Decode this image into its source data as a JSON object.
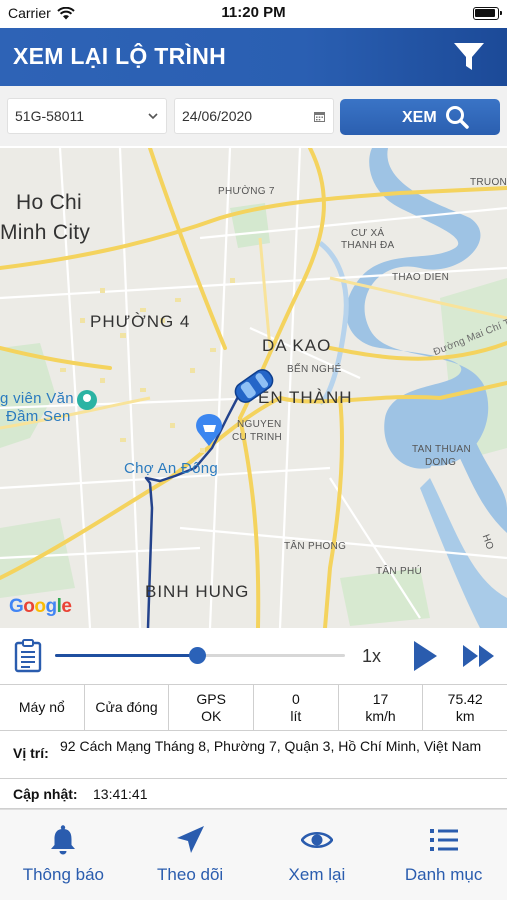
{
  "status_bar": {
    "carrier": "Carrier",
    "time": "11:20 PM"
  },
  "header": {
    "title": "XEM LẠI LỘ TRÌNH"
  },
  "filters": {
    "vehicle": "51G-58011",
    "date": "24/06/2020",
    "view_button": "XEM"
  },
  "map": {
    "labels": {
      "hcmc_line1": "Ho Chi",
      "hcmc_line2": "Minh City",
      "phuong7": "PHƯỜNG 7",
      "truong": "TRUON",
      "cuxa1": "CƯ XÁ",
      "cuxa2": "THANH ĐA",
      "thaodien": "THAO DIEN",
      "phuong4": "PHƯỜNG 4",
      "dakao": "DA KAO",
      "bennghe": "BẾN NGHÉ",
      "benthanh": "ẾN THÀNH",
      "maichitho": "Đường Mai Chí Thọ",
      "park1": "g viên Văn",
      "park2": "Đầm Sen",
      "nguyen": "NGUYEN",
      "cutrinh": "CU TRINH",
      "tanthuan1": "TAN THUAN",
      "tanthuan2": "DONG",
      "choandong": "Chợ An Đông",
      "tanphong": "TÂN PHONG",
      "tanphu": "TÂN PHÚ",
      "ho": "HO",
      "binhhung": "BINH HUNG"
    },
    "attribution": "Google"
  },
  "playback": {
    "speed": "1x",
    "progress": 0.49
  },
  "stats": [
    {
      "line1": "Máy nổ",
      "line2": ""
    },
    {
      "line1": "Cửa đóng",
      "line2": ""
    },
    {
      "line1": "GPS",
      "line2": "OK"
    },
    {
      "line1": "0",
      "line2": "lít"
    },
    {
      "line1": "17",
      "line2": "km/h"
    },
    {
      "line1": "75.42",
      "line2": "km"
    }
  ],
  "location": {
    "label": "Vị trí:",
    "value": "92 Cách Mạng Tháng 8, Phường 7, Quận 3, Hồ Chí Minh, Việt Nam"
  },
  "updated": {
    "label": "Cập nhật:",
    "value": "13:41:41"
  },
  "tabs": [
    {
      "label": "Thông báo",
      "icon": "bell-icon"
    },
    {
      "label": "Theo dõi",
      "icon": "navigation-arrow-icon"
    },
    {
      "label": "Xem lại",
      "icon": "eye-icon"
    },
    {
      "label": "Danh mục",
      "icon": "list-icon"
    }
  ],
  "colors": {
    "primary": "#2b5fb0",
    "route": "#24438c"
  }
}
